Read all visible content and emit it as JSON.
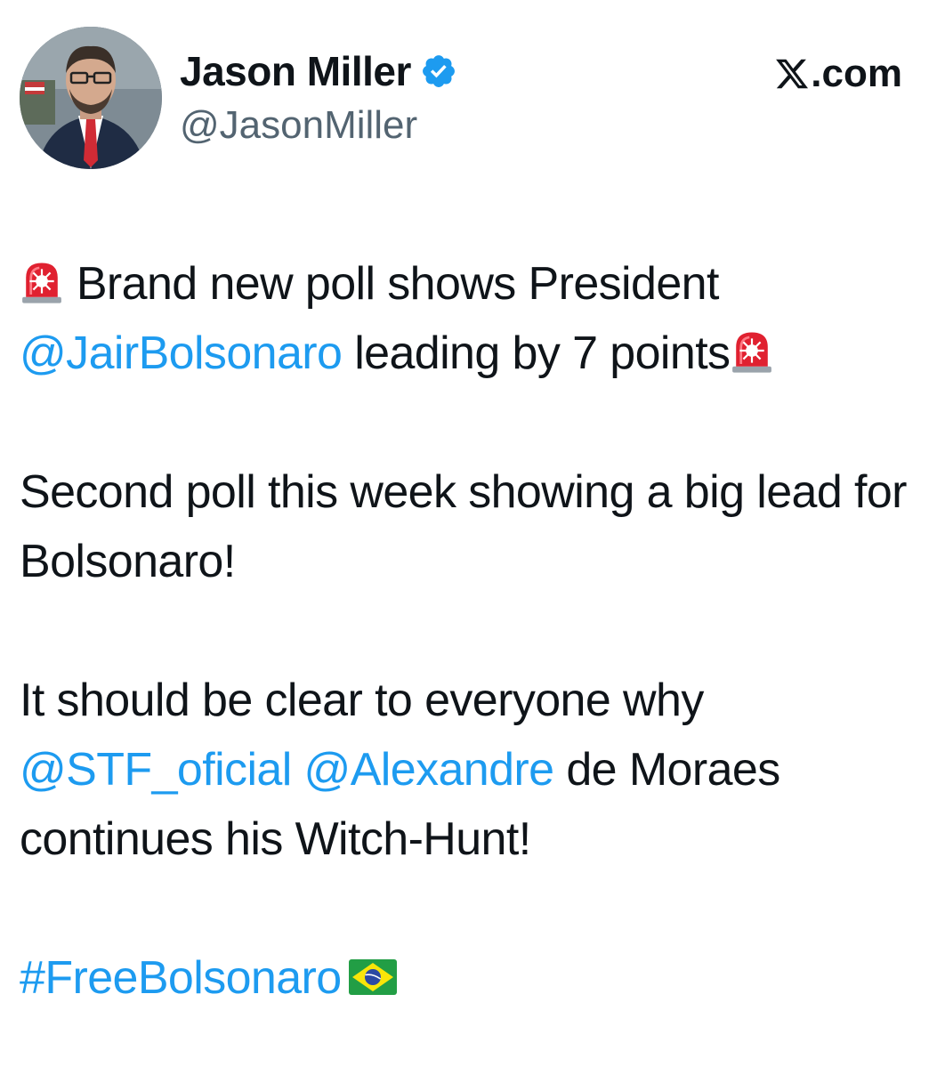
{
  "author": {
    "display_name": "Jason Miller",
    "handle": "@JasonMiller",
    "verified": true,
    "avatar_icon": "profile-photo"
  },
  "source": {
    "site_label": ".com",
    "logo_icon": "x-logo-icon"
  },
  "tweet": {
    "paragraph1": {
      "emoji_start": "siren-icon",
      "text_a": " Brand new poll shows President ",
      "mention": "@JairBolsonaro",
      "text_b": " leading by 7 points",
      "emoji_end": "siren-icon"
    },
    "paragraph2": {
      "text": "Second poll this week showing a big lead for Bolsonaro!"
    },
    "paragraph3": {
      "text_a": "It should be clear to everyone why ",
      "mention1": "@STF_oficial",
      "mention2": "@Alexandre",
      "text_b": " de Moraes continues his Witch-Hunt!"
    },
    "paragraph4": {
      "hashtag": "#FreeBolsonaro",
      "emoji": "brazil-flag-icon"
    }
  },
  "colors": {
    "link": "#1d9bf0",
    "text": "#0f1419",
    "secondary": "#536471",
    "verified": "#1d9bf0"
  }
}
